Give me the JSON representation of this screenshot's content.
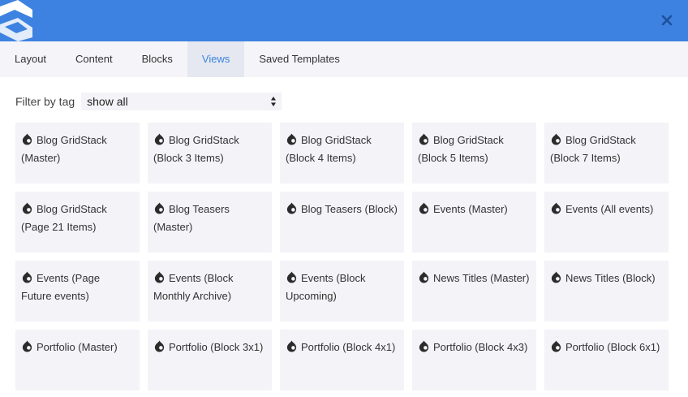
{
  "header": {
    "close_icon": "close-icon",
    "color": "#3d82e0"
  },
  "tabs": [
    {
      "label": "Layout",
      "active": false
    },
    {
      "label": "Content",
      "active": false
    },
    {
      "label": "Blocks",
      "active": false
    },
    {
      "label": "Views",
      "active": true
    },
    {
      "label": "Saved Templates",
      "active": false
    }
  ],
  "filter": {
    "label": "Filter by tag",
    "value": "show all"
  },
  "views": [
    "Blog GridStack (Master)",
    "Blog GridStack (Block 3 Items)",
    "Blog GridStack (Block 4 Items)",
    "Blog GridStack (Block 5 Items)",
    "Blog GridStack (Block 7 Items)",
    "Blog GridStack (Page 21 Items)",
    "Blog Teasers (Master)",
    "Blog Teasers (Block)",
    "Events (Master)",
    "Events (All events)",
    "Events (Page Future events)",
    "Events (Block Monthly Archive)",
    "Events (Block Upcoming)",
    "News Titles (Master)",
    "News Titles (Block)",
    "Portfolio (Master)",
    "Portfolio (Block 3x1)",
    "Portfolio (Block 4x1)",
    "Portfolio (Block 4x3)",
    "Portfolio (Block 6x1)"
  ]
}
